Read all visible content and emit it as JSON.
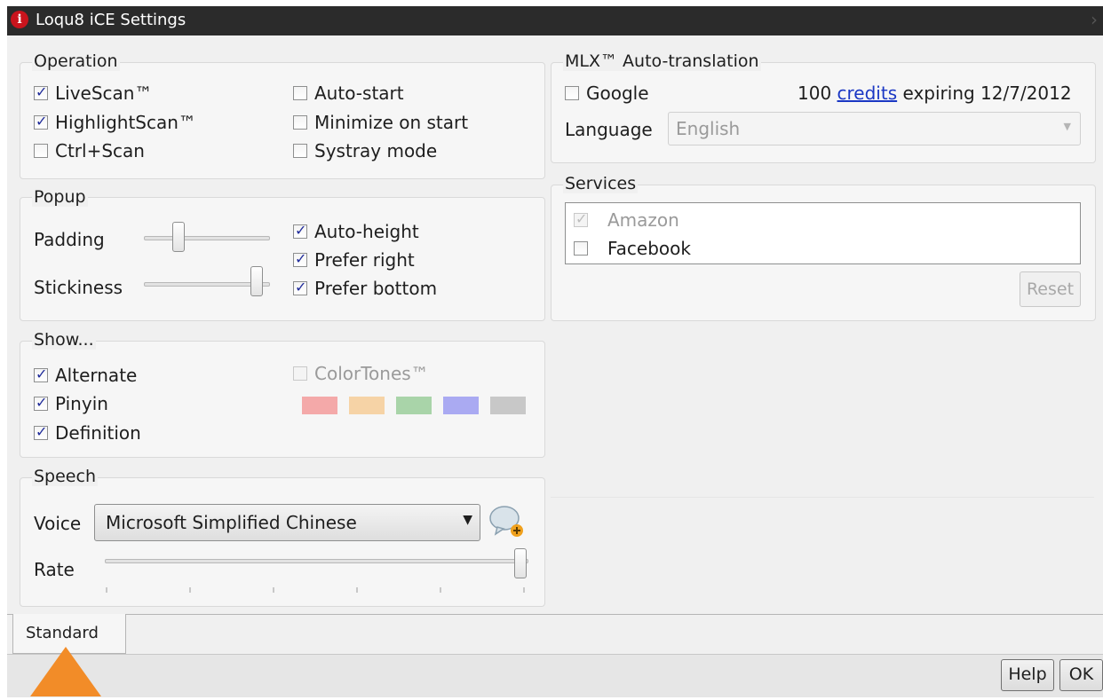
{
  "window": {
    "title": "Loqu8 iCE Settings"
  },
  "operation": {
    "legend": "Operation",
    "livescan": {
      "label": "LiveScan™",
      "checked": true
    },
    "highlightscan": {
      "label": "HighlightScan™",
      "checked": true
    },
    "ctrlscan": {
      "label": "Ctrl+Scan",
      "checked": false
    },
    "autostart": {
      "label": "Auto-start",
      "checked": false
    },
    "minimize": {
      "label": "Minimize on start",
      "checked": false
    },
    "systray": {
      "label": "Systray mode",
      "checked": false
    }
  },
  "popup": {
    "legend": "Popup",
    "padding_label": "Padding",
    "stickiness_label": "Stickiness",
    "padding_level": 0.25,
    "stickiness_level": 0.95,
    "autoheight": {
      "label": "Auto-height",
      "checked": true
    },
    "preferright": {
      "label": "Prefer right",
      "checked": true
    },
    "preferbottom": {
      "label": "Prefer bottom",
      "checked": true
    }
  },
  "show": {
    "legend": "Show...",
    "alternate": {
      "label": "Alternate",
      "checked": true
    },
    "pinyin": {
      "label": "Pinyin",
      "checked": true
    },
    "definition": {
      "label": "Definition",
      "checked": true
    },
    "colortones": {
      "label": "ColorTones™",
      "checked": false,
      "enabled": false
    },
    "swatches": [
      "#f4a9a9",
      "#f6d3a6",
      "#a9d4a9",
      "#aaaaf2",
      "#c8c8c8"
    ]
  },
  "speech": {
    "legend": "Speech",
    "voice_label": "Voice",
    "voice_value": "Microsoft Simplified Chinese",
    "rate_label": "Rate",
    "rate_level": 1.0
  },
  "mlx": {
    "legend": "MLX™ Auto-translation",
    "google": {
      "label": "Google",
      "checked": false
    },
    "credits_prefix": "100 ",
    "credits_link": "credits",
    "credits_suffix": " expiring 12/7/2012",
    "language_label": "Language",
    "language_value": "English"
  },
  "services": {
    "legend": "Services",
    "items": [
      {
        "label": "Amazon",
        "checked": true,
        "enabled": false
      },
      {
        "label": "Facebook",
        "checked": false,
        "enabled": true
      }
    ],
    "reset_label": "Reset"
  },
  "tabs": {
    "standard": "Standard"
  },
  "buttons": {
    "help": "Help",
    "ok": "OK"
  },
  "colors": {
    "titlebar": "#2b2b2b",
    "link": "#1a37c4",
    "pointer": "#f28c28"
  }
}
